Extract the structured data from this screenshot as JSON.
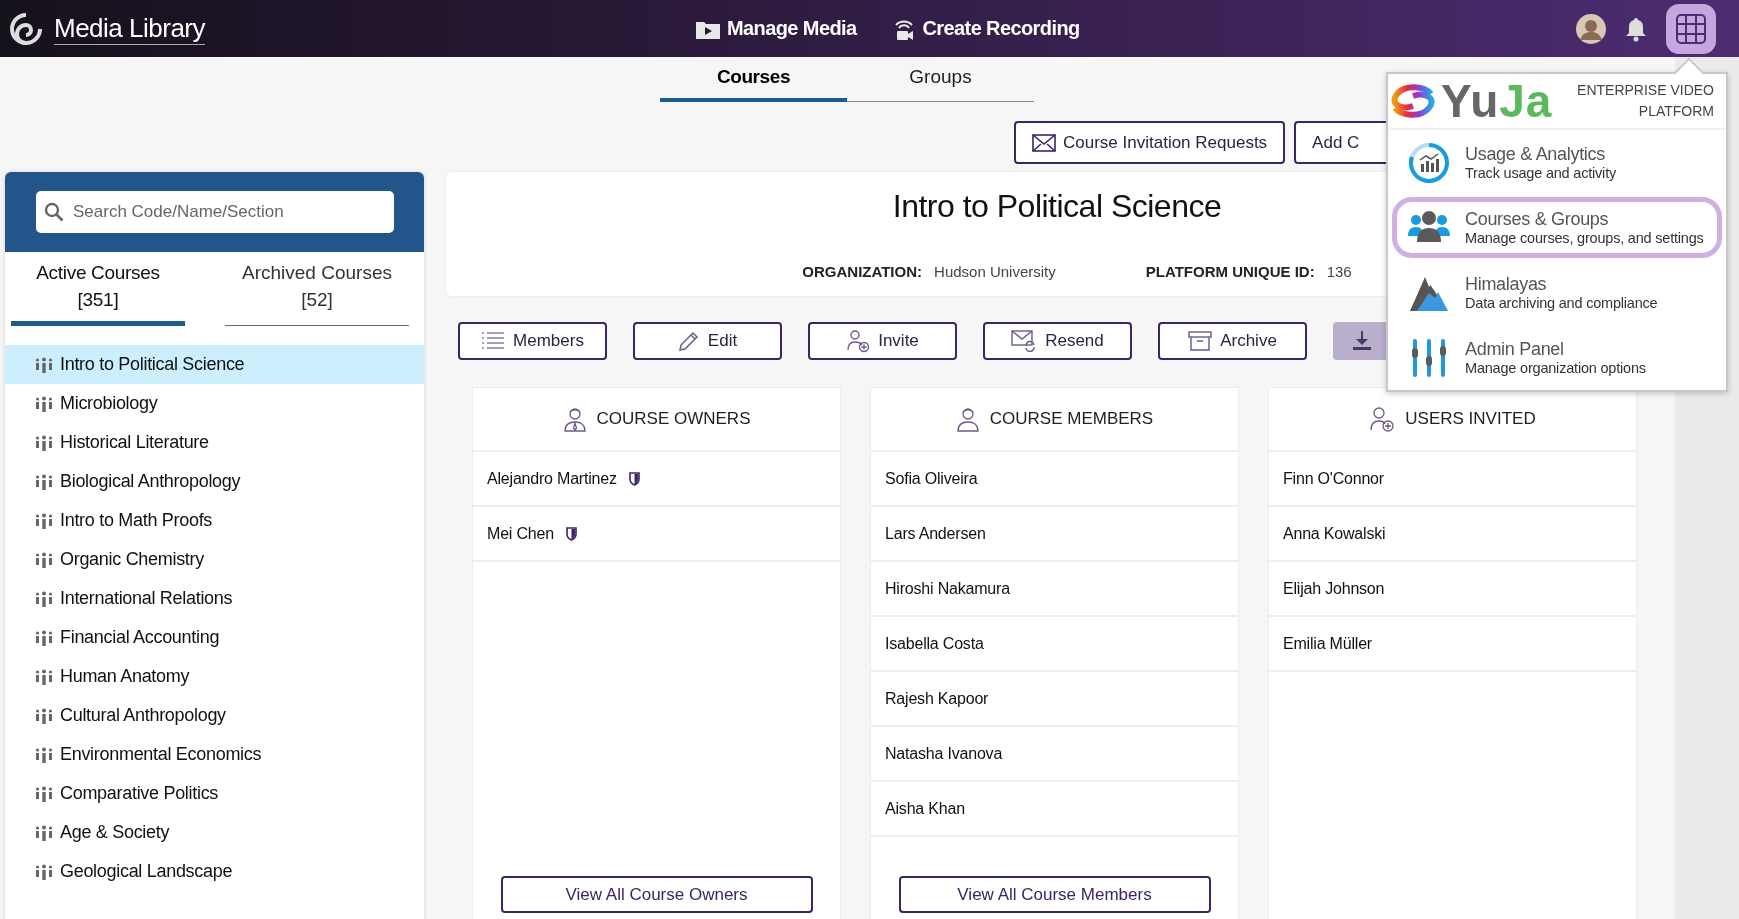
{
  "topbar": {
    "title": "Media Library",
    "nav": [
      {
        "label": "Manage Media",
        "kind": "media"
      },
      {
        "label": "Create Recording",
        "kind": "recording"
      }
    ]
  },
  "subtabs": [
    {
      "label": "Courses",
      "selected": true
    },
    {
      "label": "Groups",
      "selected": false
    }
  ],
  "toolbar": {
    "buttons": [
      {
        "label": "Course Invitation Requests",
        "kind": "mail"
      },
      {
        "label": "Add C",
        "kind": "plain"
      }
    ]
  },
  "sidebar": {
    "search": {
      "placeholder": "Search Code/Name/Section"
    },
    "tabs": [
      {
        "label": "Active Courses",
        "count": "[351]",
        "selected": true
      },
      {
        "label": "Archived Courses",
        "count": "[52]",
        "selected": false
      }
    ],
    "courses": [
      {
        "name": "Intro to Political Science",
        "selected": true
      },
      {
        "name": "Microbiology",
        "selected": false
      },
      {
        "name": "Historical Literature",
        "selected": false
      },
      {
        "name": "Biological Anthropology",
        "selected": false
      },
      {
        "name": "Intro to Math Proofs",
        "selected": false
      },
      {
        "name": "Organic Chemistry",
        "selected": false
      },
      {
        "name": "International Relations",
        "selected": false
      },
      {
        "name": "Financial Accounting",
        "selected": false
      },
      {
        "name": "Human Anatomy",
        "selected": false
      },
      {
        "name": "Cultural Anthropology",
        "selected": false
      },
      {
        "name": "Environmental Economics",
        "selected": false
      },
      {
        "name": "Comparative Politics",
        "selected": false
      },
      {
        "name": "Age & Society",
        "selected": false
      },
      {
        "name": "Geological Landscape",
        "selected": false
      }
    ]
  },
  "course": {
    "title": "Intro to Political Science",
    "details": [
      {
        "label": "ORGANIZATION:",
        "value": "Hudson University"
      },
      {
        "label": "PLATFORM UNIQUE ID:",
        "value": "136"
      }
    ],
    "actions": [
      {
        "label": "Members",
        "kind": "list"
      },
      {
        "label": "Edit",
        "kind": "edit"
      },
      {
        "label": "Invite",
        "kind": "invite"
      },
      {
        "label": "Resend",
        "kind": "resend"
      },
      {
        "label": "Archive",
        "kind": "archive"
      }
    ]
  },
  "columns": [
    {
      "title": "COURSE OWNERS",
      "kind": "owner",
      "people": [
        {
          "name": "Alejandro Martinez",
          "shield": true
        },
        {
          "name": "Mei Chen",
          "shield": true
        }
      ],
      "button": "View All Course Owners"
    },
    {
      "title": "COURSE MEMBERS",
      "kind": "member",
      "people": [
        {
          "name": "Sofia Oliveira"
        },
        {
          "name": "Lars Andersen"
        },
        {
          "name": "Hiroshi Nakamura"
        },
        {
          "name": "Isabella Costa"
        },
        {
          "name": "Rajesh Kapoor"
        },
        {
          "name": "Natasha Ivanova"
        },
        {
          "name": "Aisha Khan"
        }
      ],
      "button": "View All Course Members"
    },
    {
      "title": "USERS INVITED",
      "kind": "invited",
      "people": [
        {
          "name": "Finn O'Connor"
        },
        {
          "name": "Anna Kowalski"
        },
        {
          "name": "Elijah Johnson"
        },
        {
          "name": "Emilia Müller"
        }
      ]
    }
  ],
  "apps_menu": {
    "brand_parts": [
      "Yu",
      "Ja"
    ],
    "tagline": "ENTERPRISE VIDEO PLATFORM",
    "items": [
      {
        "title": "Usage & Analytics",
        "subtitle": "Track usage and activity",
        "kind": "analytics",
        "selected": false
      },
      {
        "title": "Courses & Groups",
        "subtitle": "Manage courses, groups, and settings",
        "kind": "people",
        "selected": true
      },
      {
        "title": "Himalayas",
        "subtitle": "Data archiving and compliance",
        "kind": "mountain",
        "selected": false
      },
      {
        "title": "Admin Panel",
        "subtitle": "Manage organization options",
        "kind": "sliders",
        "selected": false
      }
    ]
  }
}
